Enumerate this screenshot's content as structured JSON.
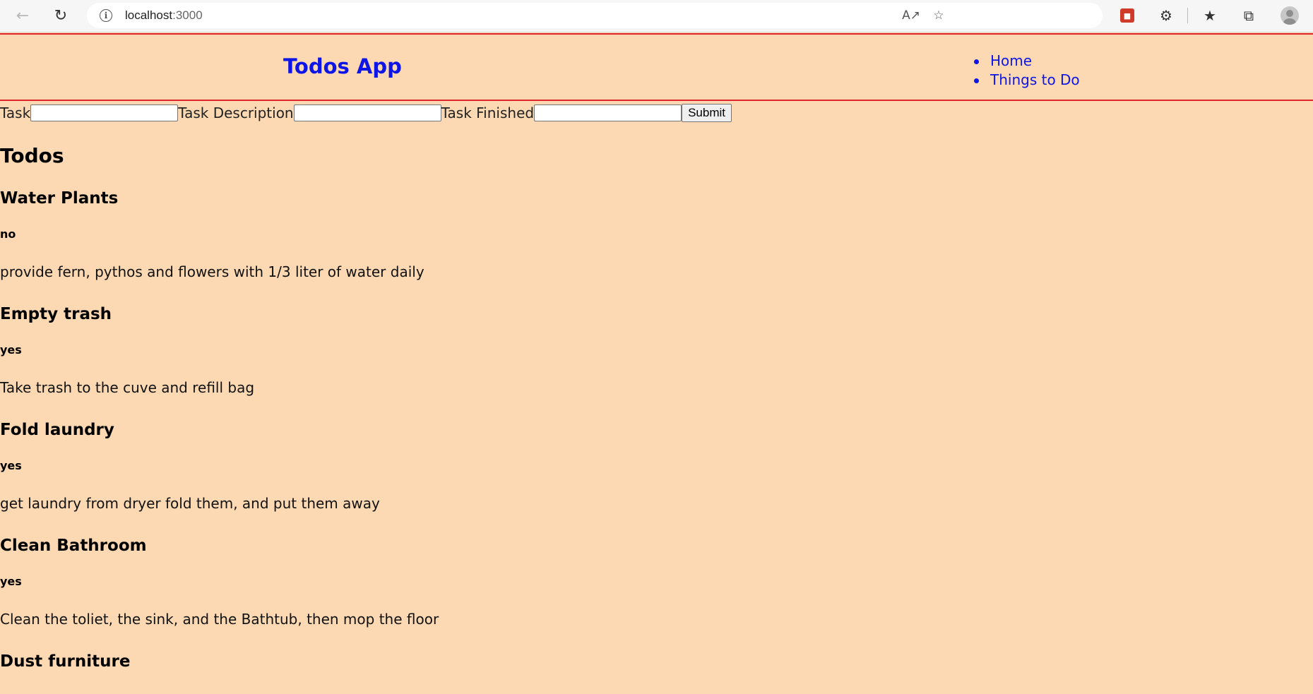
{
  "browser": {
    "url_host": "localhost",
    "url_port": ":3000",
    "back_icon": "arrow-left-icon",
    "reload_icon": "reload-icon",
    "info_icon": "info-icon",
    "read_aloud_icon": "read-aloud-icon",
    "favorite_add_icon": "star-add-icon",
    "extension_icon": "extension-icon",
    "puzzle_icon": "puzzle-icon",
    "favorites_icon": "favorites-icon",
    "collections_icon": "collections-icon",
    "profile_icon": "profile-avatar-icon"
  },
  "colors": {
    "page_background": "#fcd9b3",
    "header_border": "#e0262a",
    "link_blue": "#0d16e6"
  },
  "header": {
    "title": "Todos App",
    "nav": [
      "Home",
      "Things to Do"
    ]
  },
  "form": {
    "task_label": "Task",
    "task_value": "",
    "description_label": "Task Description",
    "description_value": "",
    "finished_label": "Task Finished",
    "finished_value": "",
    "submit_label": "Submit"
  },
  "todos_heading": "Todos",
  "todos": [
    {
      "title": "Water Plants",
      "finished": "no",
      "description": "provide fern, pythos and flowers with 1/3 liter of water daily"
    },
    {
      "title": "Empty trash",
      "finished": "yes",
      "description": "Take trash to the cuve and refill bag"
    },
    {
      "title": "Fold laundry",
      "finished": "yes",
      "description": "get laundry from dryer fold them, and put them away"
    },
    {
      "title": "Clean Bathroom",
      "finished": "yes",
      "description": "Clean the toliet, the sink, and the Bathtub, then mop the floor"
    },
    {
      "title": "Dust furniture",
      "finished": "",
      "description": ""
    }
  ]
}
